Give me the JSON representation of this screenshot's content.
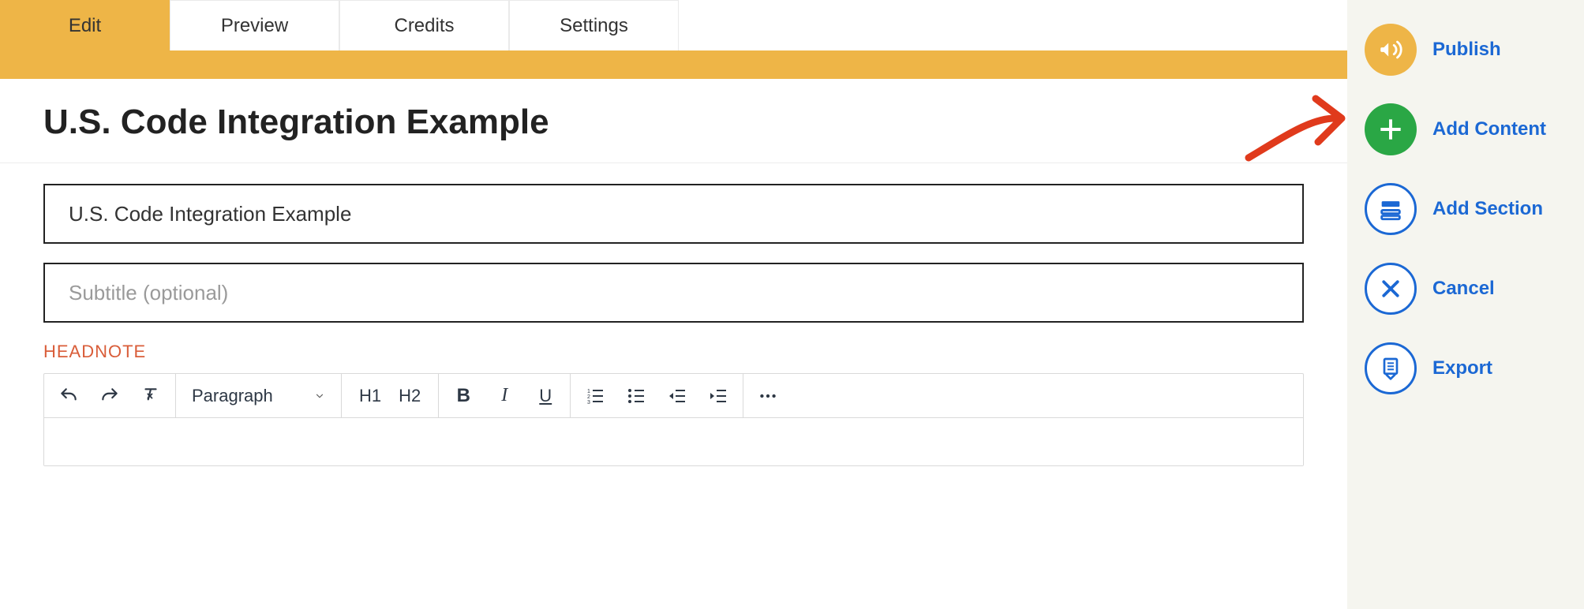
{
  "tabs": [
    "Edit",
    "Preview",
    "Credits",
    "Settings"
  ],
  "active_tab": "Edit",
  "page_title": "U.S. Code Integration Example",
  "title_input_value": "U.S. Code Integration Example",
  "subtitle_placeholder": "Subtitle (optional)",
  "headnote_label": "HEADNOTE",
  "toolbar": {
    "format_label": "Paragraph",
    "h1_label": "H1",
    "h2_label": "H2"
  },
  "side_actions": {
    "publish": "Publish",
    "add_content": "Add Content",
    "add_section": "Add Section",
    "cancel": "Cancel",
    "export": "Export"
  },
  "colors": {
    "accent_yellow": "#eeb547",
    "accent_green": "#2aa745",
    "accent_blue": "#1b68d4",
    "headnote_red": "#d95d39"
  }
}
